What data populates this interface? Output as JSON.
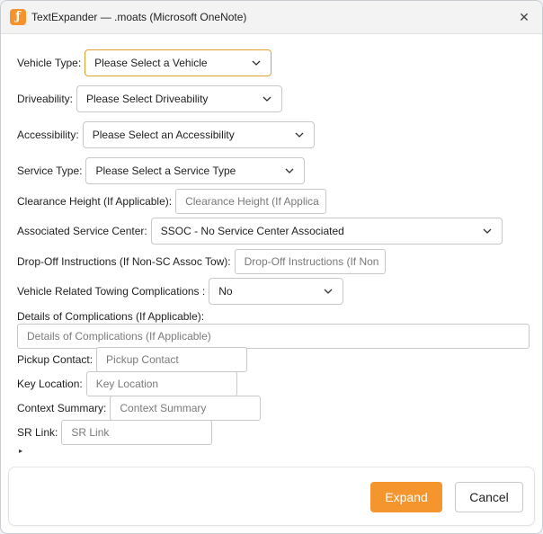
{
  "window": {
    "title": "TextExpander — .moats (Microsoft OneNote)",
    "icon": "textexpander-app-icon",
    "close_glyph": "✕"
  },
  "form": {
    "vehicle_type": {
      "label": "Vehicle Type:",
      "value": "Please Select a Vehicle"
    },
    "driveability": {
      "label": "Driveability:",
      "value": "Please Select Driveability"
    },
    "accessibility": {
      "label": "Accessibility:",
      "value": "Please Select an Accessibility"
    },
    "service_type": {
      "label": "Service Type:",
      "value": "Please Select a Service Type"
    },
    "clearance_height": {
      "label": "Clearance Height (If Applicable):",
      "placeholder": "Clearance Height (If Applica"
    },
    "associated_service_center": {
      "label": "Associated Service Center:",
      "value": "SSOC - No Service Center Associated"
    },
    "dropoff_instructions": {
      "label": "Drop-Off Instructions (If Non-SC Assoc Tow):",
      "placeholder": "Drop-Off Instructions (If Non"
    },
    "towing_complications": {
      "label": "Vehicle Related Towing Complications :",
      "value": "No"
    },
    "details_of_complications": {
      "label": "Details of Complications (If Applicable):",
      "placeholder": "Details of Complications (If Applicable)"
    },
    "pickup_contact": {
      "label": "Pickup Contact:",
      "placeholder": "Pickup Contact"
    },
    "key_location": {
      "label": "Key Location:",
      "placeholder": "Key Location"
    },
    "context_summary": {
      "label": "Context Summary:",
      "placeholder": "Context Summary"
    },
    "sr_link": {
      "label": "SR Link:",
      "placeholder": "SR Link"
    },
    "disclosure_glyph": "▸"
  },
  "footer": {
    "expand_label": "Expand",
    "cancel_label": "Cancel"
  },
  "colors": {
    "accent": "#f4962d",
    "focus_border": "#e0a030"
  }
}
